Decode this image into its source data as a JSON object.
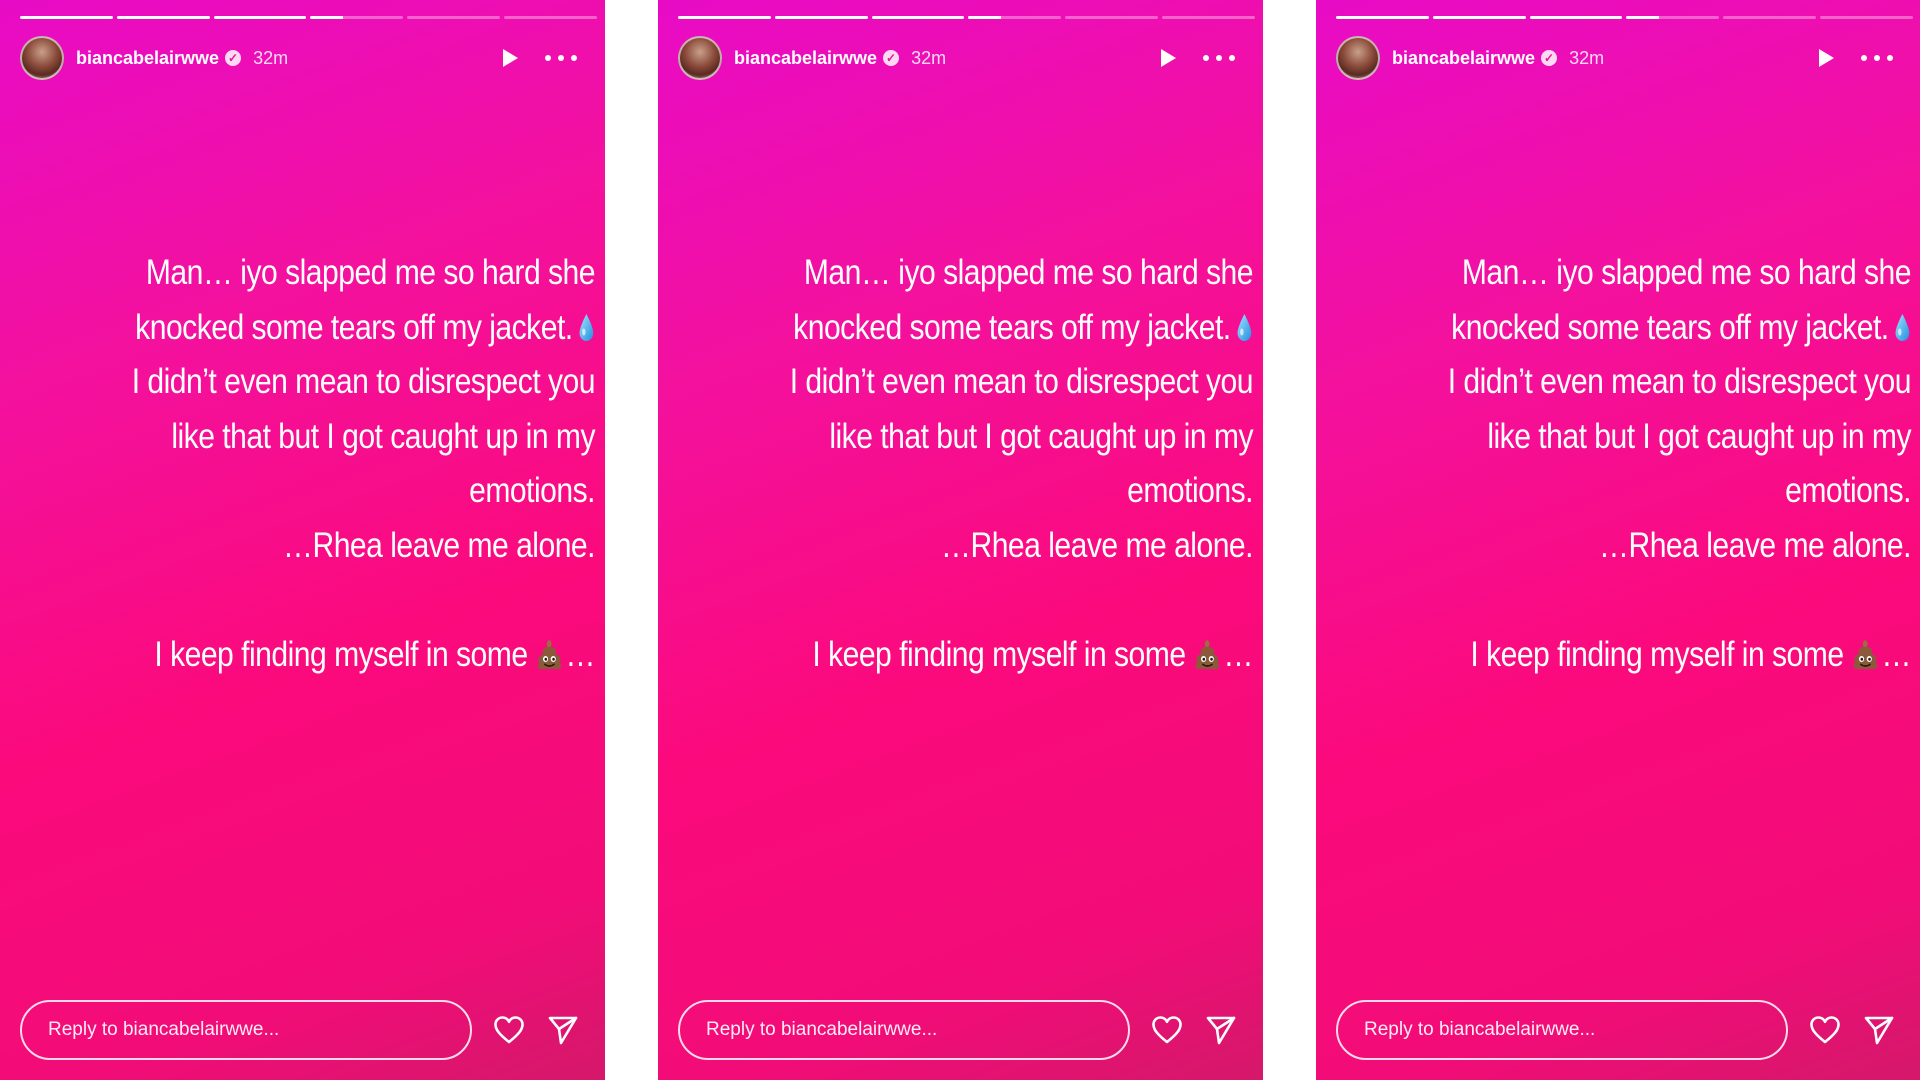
{
  "stories": [
    {
      "progress": [
        1,
        1,
        1,
        0.35,
        0,
        0
      ],
      "user": {
        "username": "biancabelairwwe",
        "verified": true,
        "time": "32m"
      },
      "caption": {
        "lines": [
          "Man… iyo slapped me so hard she",
          "knocked some tears off my jacket.",
          "I didn’t even mean to disrespect you",
          "like that but I got  caught up in my",
          "emotions.",
          "…Rhea leave me alone.",
          "",
          "I keep finding myself in some",
          "…"
        ],
        "emojis": {
          "line_2": "droplet",
          "line_8": "pile-of-poo"
        }
      },
      "reply": {
        "placeholder": "Reply to biancabelairwwe..."
      }
    },
    {
      "progress": [
        1,
        1,
        1,
        0.35,
        0,
        0
      ],
      "user": {
        "username": "biancabelairwwe",
        "verified": true,
        "time": "32m"
      },
      "caption": {
        "lines": [
          "Man… iyo slapped me so hard she",
          "knocked some tears off my jacket.",
          "I didn’t even mean to disrespect you",
          "like that but I got  caught up in my",
          "emotions.",
          "…Rhea leave me alone.",
          "",
          "I keep finding myself in some",
          "…"
        ],
        "emojis": {
          "line_2": "droplet",
          "line_8": "pile-of-poo"
        }
      },
      "reply": {
        "placeholder": "Reply to biancabelairwwe..."
      }
    },
    {
      "progress": [
        1,
        1,
        1,
        0.35,
        0,
        0
      ],
      "user": {
        "username": "biancabelairwwe",
        "verified": true,
        "time": "32m"
      },
      "caption": {
        "lines": [
          "Man… iyo slapped me so hard she",
          "knocked some tears off my jacket.",
          "I didn’t even mean to disrespect you",
          "like that but I got  caught up in my",
          "emotions.",
          "…Rhea leave me alone.",
          "",
          "I keep finding myself in some",
          "…"
        ],
        "emojis": {
          "line_2": "droplet",
          "line_8": "pile-of-poo"
        }
      },
      "reply": {
        "placeholder": "Reply to biancabelairwwe..."
      }
    }
  ],
  "icons": {
    "play": "play-icon",
    "more": "more-options-icon",
    "like": "heart-icon",
    "share": "send-icon"
  },
  "colors": {
    "gradient_top": "#e80bc6",
    "gradient_mid": "#fb0a7c",
    "gradient_bottom": "#d4186a",
    "text": "#ffffff"
  }
}
